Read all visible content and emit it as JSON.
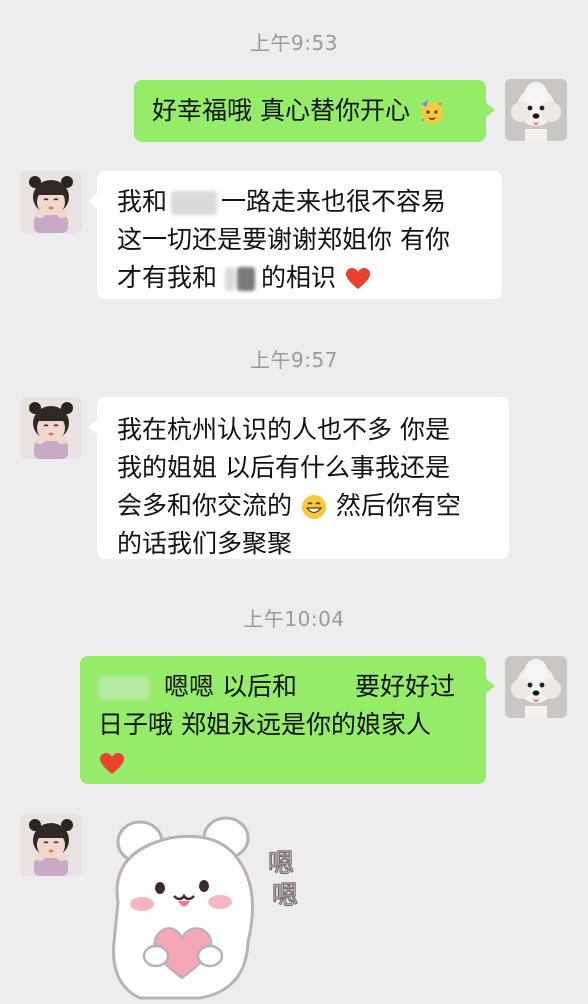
{
  "timestamps": [
    "上午9:53",
    "上午9:57",
    "上午10:04"
  ],
  "messages": {
    "m1": {
      "sender": "me",
      "text": "好幸福哦 真心替你开心",
      "emoji": "partying-face"
    },
    "m2": {
      "sender": "them",
      "line1_a": "我和",
      "line1_b": "一路走来也很不容易",
      "line2": "这一切还是要谢谢郑姐你  有你",
      "line3_a": "才有我和",
      "line3_b": "的相识",
      "emoji": "red-heart"
    },
    "m3": {
      "sender": "them",
      "line1": "我在杭州认识的人也不多 你是",
      "line2": "我的姐姐  以后有什么事我还是",
      "line3_a": "会多和你交流的",
      "line3_b": " 然后你有空",
      "line4": "的话我们多聚聚",
      "emoji": "grinning-face"
    },
    "m4": {
      "sender": "me",
      "line1_a": "嗯嗯 以后和",
      "line1_b": "要好好过",
      "line2": "日子哦  郑姐永远是你的娘家人",
      "emoji": "red-heart"
    },
    "m5": {
      "sender": "them",
      "sticker": "bear-holding-heart",
      "sticker_text": [
        "嗯",
        "嗯"
      ]
    }
  },
  "colors": {
    "background": "#ededed",
    "my_bubble": "#95ec69",
    "their_bubble": "#ffffff",
    "timestamp": "#9a9a9a"
  }
}
